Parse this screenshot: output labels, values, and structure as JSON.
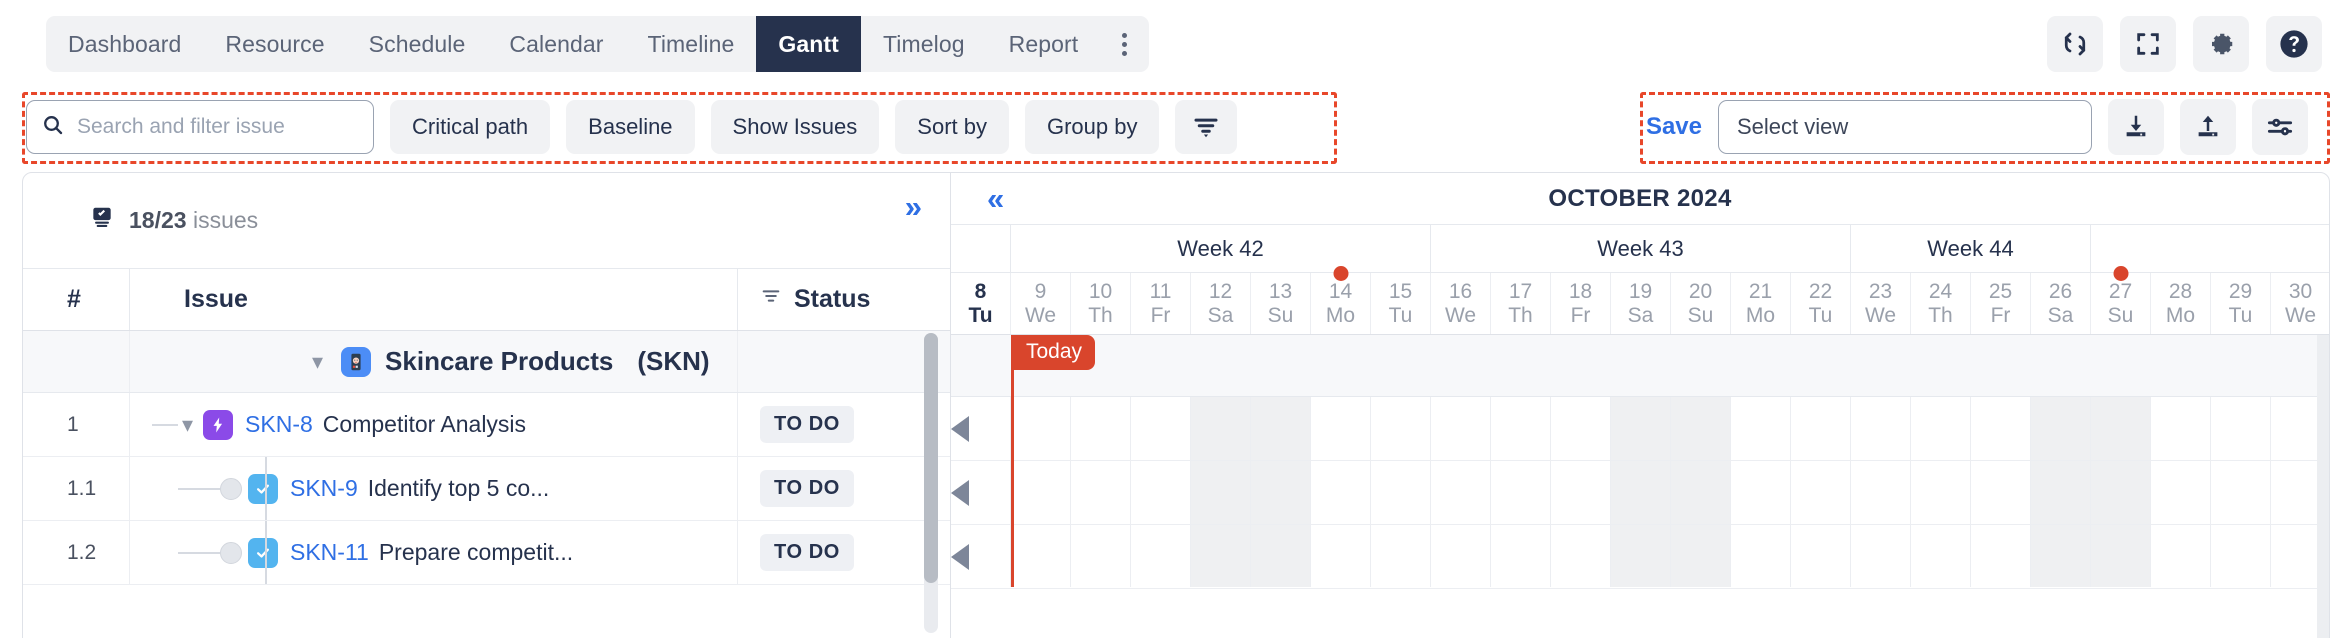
{
  "nav": {
    "tabs": [
      {
        "label": "Dashboard",
        "active": false
      },
      {
        "label": "Resource",
        "active": false
      },
      {
        "label": "Schedule",
        "active": false
      },
      {
        "label": "Calendar",
        "active": false
      },
      {
        "label": "Timeline",
        "active": false
      },
      {
        "label": "Gantt",
        "active": true
      },
      {
        "label": "Timelog",
        "active": false
      },
      {
        "label": "Report",
        "active": false
      }
    ],
    "overflow_icon": "kebab-menu-icon",
    "actions": [
      {
        "name": "refresh-icon",
        "title": "Refresh"
      },
      {
        "name": "fullscreen-icon",
        "title": "Fullscreen"
      },
      {
        "name": "gear-icon",
        "title": "Settings"
      },
      {
        "name": "help-icon",
        "title": "Help"
      }
    ]
  },
  "toolbar": {
    "search": {
      "placeholder": "Search and filter issue",
      "value": "",
      "icon": "search-icon"
    },
    "buttons": [
      {
        "label": "Critical path"
      },
      {
        "label": "Baseline"
      },
      {
        "label": "Show Issues"
      },
      {
        "label": "Sort by"
      },
      {
        "label": "Group by"
      }
    ],
    "filter_icon": "filter-funnel-icon",
    "save_label": "Save",
    "select_view": {
      "placeholder": "Select view",
      "value": ""
    },
    "right_icons": [
      {
        "name": "import-download-icon"
      },
      {
        "name": "export-upload-icon"
      },
      {
        "name": "view-settings-sliders-icon"
      }
    ]
  },
  "issues_panel": {
    "count_text": "18/23",
    "count_suffix": "issues",
    "count_icon": "issue-stack-icon",
    "expand_icon": "chevron-double-right-icon",
    "columns": [
      {
        "key": "num",
        "label": "#"
      },
      {
        "key": "issue",
        "label": "Issue"
      },
      {
        "key": "status",
        "label": "Status",
        "filter_icon": "filter-icon"
      }
    ],
    "group": {
      "title": "Skincare Products",
      "code": "(SKN)",
      "icon": "project-avatar-icon",
      "chevron": "chevron-down-icon"
    },
    "rows": [
      {
        "num": "1",
        "key": "SKN-8",
        "summary": "Competitor Analysis",
        "status": "TO DO",
        "type": "epic",
        "indent": 0
      },
      {
        "num": "1.1",
        "key": "SKN-9",
        "summary": "Identify top 5 co...",
        "status": "TO DO",
        "type": "task",
        "indent": 1
      },
      {
        "num": "1.2",
        "key": "SKN-11",
        "summary": "Prepare competit...",
        "status": "TO DO",
        "type": "task",
        "indent": 1
      }
    ]
  },
  "gantt": {
    "collapse_icon": "chevron-double-left-icon",
    "month": "OCTOBER 2024",
    "today_label": "Today",
    "weeks": [
      {
        "label": "",
        "span": 1
      },
      {
        "label": "Week 42",
        "span": 7
      },
      {
        "label": "Week 43",
        "span": 7
      },
      {
        "label": "Week 44",
        "span": 4
      }
    ],
    "days": [
      {
        "num": "8",
        "dow": "Tu",
        "today": true,
        "weekend": false,
        "milestone": false
      },
      {
        "num": "9",
        "dow": "We",
        "today": false,
        "weekend": false,
        "milestone": false
      },
      {
        "num": "10",
        "dow": "Th",
        "today": false,
        "weekend": false,
        "milestone": false
      },
      {
        "num": "11",
        "dow": "Fr",
        "today": false,
        "weekend": false,
        "milestone": false
      },
      {
        "num": "12",
        "dow": "Sa",
        "today": false,
        "weekend": true,
        "milestone": false
      },
      {
        "num": "13",
        "dow": "Su",
        "today": false,
        "weekend": true,
        "milestone": false
      },
      {
        "num": "14",
        "dow": "Mo",
        "today": false,
        "weekend": false,
        "milestone": true
      },
      {
        "num": "15",
        "dow": "Tu",
        "today": false,
        "weekend": false,
        "milestone": false
      },
      {
        "num": "16",
        "dow": "We",
        "today": false,
        "weekend": false,
        "milestone": false
      },
      {
        "num": "17",
        "dow": "Th",
        "today": false,
        "weekend": false,
        "milestone": false
      },
      {
        "num": "18",
        "dow": "Fr",
        "today": false,
        "weekend": false,
        "milestone": false
      },
      {
        "num": "19",
        "dow": "Sa",
        "today": false,
        "weekend": true,
        "milestone": false
      },
      {
        "num": "20",
        "dow": "Su",
        "today": false,
        "weekend": true,
        "milestone": false
      },
      {
        "num": "21",
        "dow": "Mo",
        "today": false,
        "weekend": false,
        "milestone": false
      },
      {
        "num": "22",
        "dow": "Tu",
        "today": false,
        "weekend": false,
        "milestone": false
      },
      {
        "num": "23",
        "dow": "We",
        "today": false,
        "weekend": false,
        "milestone": false
      },
      {
        "num": "24",
        "dow": "Th",
        "today": false,
        "weekend": false,
        "milestone": false
      },
      {
        "num": "25",
        "dow": "Fr",
        "today": false,
        "weekend": false,
        "milestone": false
      },
      {
        "num": "26",
        "dow": "Sa",
        "today": false,
        "weekend": true,
        "milestone": false
      },
      {
        "num": "27",
        "dow": "Su",
        "today": false,
        "weekend": true,
        "milestone": true
      },
      {
        "num": "28",
        "dow": "Mo",
        "today": false,
        "weekend": false,
        "milestone": false
      },
      {
        "num": "29",
        "dow": "Tu",
        "today": false,
        "weekend": false,
        "milestone": false
      },
      {
        "num": "30",
        "dow": "We",
        "today": false,
        "weekend": false,
        "milestone": false
      }
    ]
  },
  "colors": {
    "accent_blue": "#2f6fe4",
    "nav_active": "#26324d",
    "highlight_red": "#e8472a",
    "today_red": "#d9452c",
    "epic_purple": "#8b4ae8",
    "task_blue": "#53b4ef"
  }
}
